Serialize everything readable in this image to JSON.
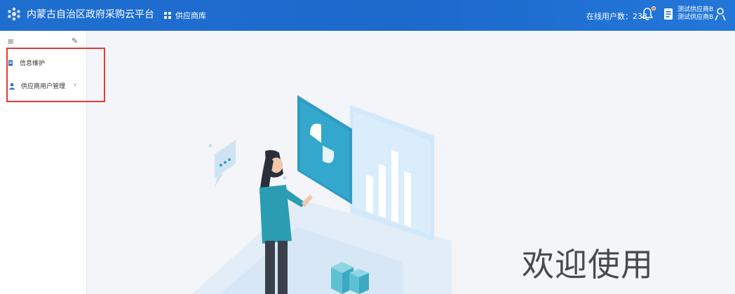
{
  "header": {
    "app_title": "内蒙古自治区政府采购云平台",
    "nav_label": "供应商库",
    "online_users": "在线用户数：233",
    "user_line1": "测试供应商B",
    "user_line2": "测试供应商B",
    "brand_color": "#1f6fd1"
  },
  "sidebar": {
    "items": [
      {
        "label": "信息维护",
        "icon": "edit-doc-icon"
      },
      {
        "label": "供应商用户管理",
        "icon": "users-icon",
        "expandable": true
      }
    ]
  },
  "main": {
    "welcome_text": "欢迎使用"
  },
  "colors": {
    "header_bg": "#1f6fd1",
    "highlight_border": "#e53935",
    "illustration_teal": "#2aa6c3"
  }
}
